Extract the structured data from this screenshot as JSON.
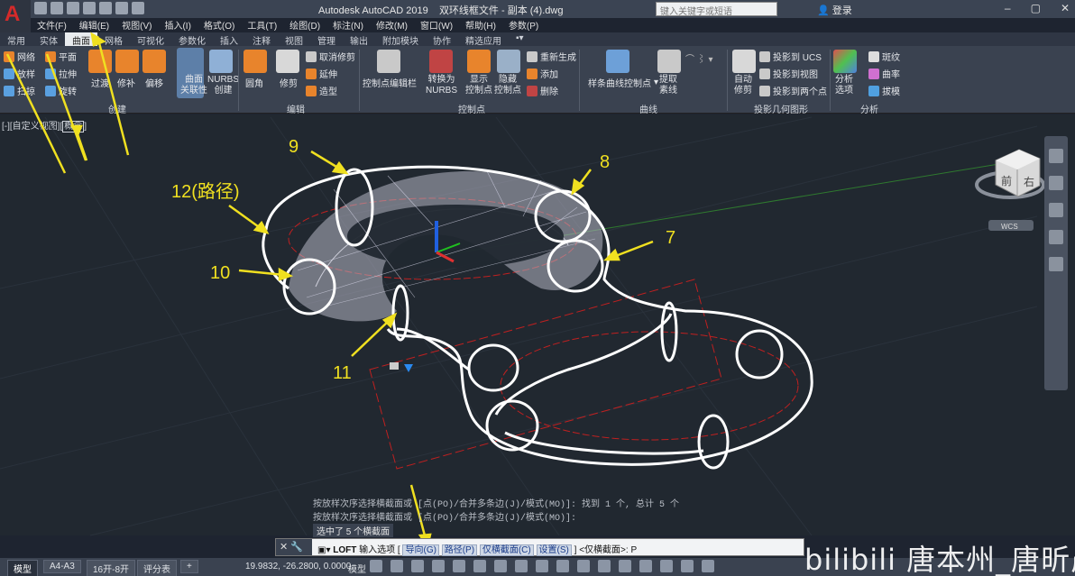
{
  "titlebar": {
    "app_title": "Autodesk AutoCAD 2019",
    "file_title": "双环线框文件 - 副本 (4).dwg",
    "search_placeholder": "键入关键字或短语",
    "login_label": "登录"
  },
  "menubar": {
    "items": [
      "文件(F)",
      "编辑(E)",
      "视图(V)",
      "插入(I)",
      "格式(O)",
      "工具(T)",
      "绘图(D)",
      "标注(N)",
      "修改(M)",
      "窗口(W)",
      "帮助(H)",
      "参数(P)"
    ]
  },
  "ribbon_tabs": {
    "items": [
      "常用",
      "实体",
      "曲面",
      "网格",
      "可视化",
      "参数化",
      "插入",
      "注释",
      "视图",
      "管理",
      "输出",
      "附加模块",
      "协作",
      "精选应用"
    ],
    "active": "曲面"
  },
  "ribbon": {
    "create": {
      "net": "网络",
      "plane": "平面",
      "loft": "放样",
      "extrude": "拉伸",
      "sweep": "扫掠",
      "revolve": "旋转",
      "transition": "过渡",
      "patch": "修补",
      "offset": "偏移",
      "associativity": "曲面\n关联性",
      "associativity_l1": "曲面",
      "associativity_l2": "关联性",
      "nurbs_l1": "NURBS",
      "nurbs_l2": "创建",
      "panel": "创建"
    },
    "edit": {
      "fillet": "圆角",
      "trim": "修剪",
      "untrim": "取消修剪",
      "extend": "延伸",
      "sculpt": "造型",
      "panel": "编辑"
    },
    "controlpoints": {
      "cv_editbar": "控制点编辑栏",
      "convert_l1": "转换为",
      "convert_l2": "NURBS",
      "show_l1": "显示",
      "show_l2": "控制点",
      "hide_l1": "隐藏",
      "hide_l2": "控制点",
      "rebuild": "重新生成",
      "add": "添加",
      "delete": "删除",
      "panel": "控制点"
    },
    "curves": {
      "spline_cv": "样条曲线控制点",
      "extract_l1": "提取",
      "extract_l2": "素线",
      "panel": "曲线"
    },
    "projection": {
      "auto_l1": "自动",
      "auto_l2": "修剪",
      "to_ucs": "投影到 UCS",
      "to_view": "投影到视图",
      "to_two_points": "投影到两个点",
      "panel": "投影几何图形"
    },
    "analysis": {
      "analysis_l1": "分析",
      "analysis_l2": "选项",
      "zebra": "斑纹",
      "curvature": "曲率",
      "draft": "拔模",
      "panel": "分析"
    }
  },
  "viewport": {
    "label_prefix": "[-][自定义视图][",
    "visual_style": "概念",
    "label_suffix": "]",
    "viewcube_front": "前",
    "viewcube_right": "右",
    "wcs": "WCS"
  },
  "annotations": {
    "n9": "9",
    "n8": "8",
    "n7": "7",
    "n10": "10",
    "n11": "11",
    "n12": "12(路径)"
  },
  "command": {
    "history_1": "按放样次序选择横截面或 [点(PO)/合并多条边(J)/模式(MO)]: 找到 1 个, 总计 5 个",
    "history_2": "按放样次序选择横截面或 [点(PO)/合并多条边(J)/模式(MO)]:",
    "history_3": "选中了 5 个横截面",
    "prompt_cmd": "LOFT",
    "prompt_text": "输入选项",
    "opt_guide": "导向(G)",
    "opt_path": "路径(P)",
    "opt_cross": "仅横截面(C)",
    "opt_settings": "设置(S)",
    "prompt_tail": "] <仅横截面>:",
    "input_value": "P"
  },
  "statusbar": {
    "tabs": [
      "模型",
      "A4-A3",
      "16开-8开",
      "评分表"
    ],
    "add_tab": "+",
    "coords": "19.9832, -26.2800, 0.0000",
    "model_label": "模型"
  },
  "watermark": "bilibili 唐本州_唐昕晨",
  "colors": {
    "accent": "#f0e020",
    "autocad_red": "#d42a2a",
    "viewport_bg": "#212830"
  }
}
